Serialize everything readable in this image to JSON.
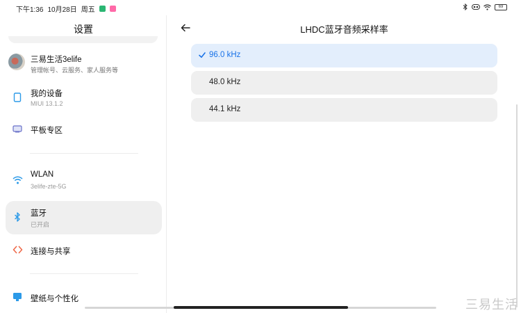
{
  "status": {
    "time": "下午1:36",
    "date": "10月28日",
    "weekday": "周五",
    "battery": "69"
  },
  "left": {
    "title": "设置",
    "profile": {
      "name": "三易生活3elife",
      "subtitle": "管理帐号、云服务、家人服务等"
    },
    "items": [
      {
        "title": "我的设备",
        "subtitle": "MIUI 13.1.2",
        "icon": "tablet-icon"
      },
      {
        "title": "平板专区",
        "subtitle": "",
        "icon": "tablet-zone-icon"
      },
      {
        "title": "WLAN",
        "subtitle": "3elife-zte-5G",
        "icon": "wifi-icon"
      },
      {
        "title": "蓝牙",
        "subtitle": "已开启",
        "icon": "bluetooth-icon"
      },
      {
        "title": "连接与共享",
        "subtitle": "",
        "icon": "connect-share-icon"
      },
      {
        "title": "壁纸与个性化",
        "subtitle": "",
        "icon": "wallpaper-icon"
      }
    ]
  },
  "right": {
    "title": "LHDC蓝牙音频采样率",
    "options": [
      {
        "label": "96.0 kHz",
        "selected": true
      },
      {
        "label": "48.0 kHz",
        "selected": false
      },
      {
        "label": "44.1 kHz",
        "selected": false
      }
    ]
  },
  "colors": {
    "accent": "#1a73e8",
    "selected_option_bg": "#e3eefc",
    "selected_item_bg": "#efefef"
  }
}
